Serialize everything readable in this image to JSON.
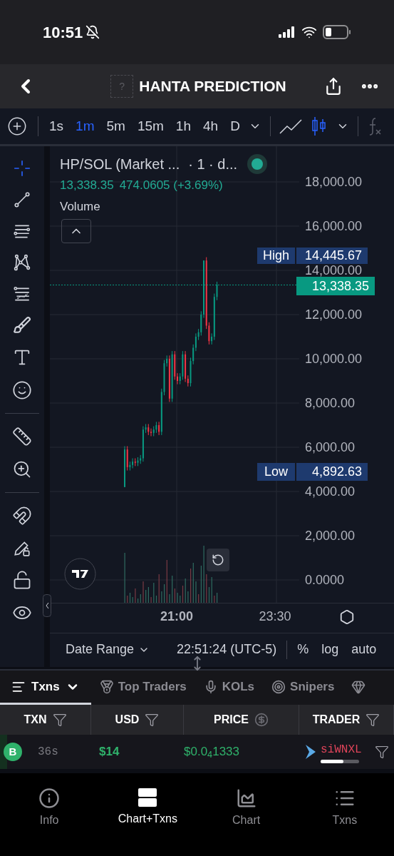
{
  "status_bar": {
    "time": "10:51"
  },
  "header": {
    "logo_placeholder": "?",
    "title": "HANTA PREDICTION"
  },
  "intervals": [
    {
      "label": "1s",
      "selected": false
    },
    {
      "label": "1m",
      "selected": true
    },
    {
      "label": "5m",
      "selected": false
    },
    {
      "label": "15m",
      "selected": false
    },
    {
      "label": "1h",
      "selected": false
    },
    {
      "label": "4h",
      "selected": false
    },
    {
      "label": "D",
      "selected": false
    }
  ],
  "chart_styles": [
    {
      "kind": "line",
      "selected": false
    },
    {
      "kind": "candles",
      "selected": true
    }
  ],
  "drawing_tools": [
    {
      "kind": "crosshair",
      "selected": true
    },
    {
      "kind": "trend-line",
      "selected": false
    },
    {
      "kind": "parallel-lines",
      "selected": false
    },
    {
      "kind": "pattern",
      "selected": false
    },
    {
      "kind": "fib",
      "selected": false
    },
    {
      "kind": "brush",
      "selected": false
    },
    {
      "kind": "text",
      "selected": false
    },
    {
      "kind": "emoji",
      "selected": false
    },
    {
      "kind": "divider"
    },
    {
      "kind": "ruler",
      "selected": false
    },
    {
      "kind": "zoom",
      "selected": false
    },
    {
      "kind": "divider"
    },
    {
      "kind": "magnet",
      "selected": false
    },
    {
      "kind": "pencil-lock",
      "selected": false
    },
    {
      "kind": "unlock",
      "selected": false
    },
    {
      "kind": "eye",
      "selected": false
    }
  ],
  "chart": {
    "symbol": "HP/SOL (Market ...",
    "interval": "· 1 · d...",
    "live": true,
    "last": "13,338.35",
    "change": "474.0605 (+3.69%)",
    "indicator": "Volume",
    "price_axis": [
      "18,000.00",
      "16,000.00",
      "14,000.00",
      "12,000.00",
      "10,000.00",
      "8,000.00",
      "6,000.00",
      "4,000.00",
      "2,000.00",
      "0.0000"
    ],
    "time_axis": [
      "21:00",
      "23:30"
    ],
    "high": {
      "label": "High",
      "value": "14,445.67"
    },
    "current_price": "13,338.35",
    "low": {
      "label": "Low",
      "value": "4,892.63"
    }
  },
  "range_bar": {
    "date_range": "Date Range",
    "clock": "22:51:24 (UTC-5)",
    "options": [
      "%",
      "log",
      "auto"
    ]
  },
  "tabs": [
    {
      "kind": "list",
      "label": "Txns",
      "selected": true
    },
    {
      "kind": "medal",
      "label": "Top Traders",
      "selected": false
    },
    {
      "kind": "mic",
      "label": "KOLs",
      "selected": false
    },
    {
      "kind": "target",
      "label": "Snipers",
      "selected": false
    },
    {
      "kind": "gem",
      "selected": false
    }
  ],
  "table": {
    "columns": [
      {
        "label": "TXN",
        "kind": "filter"
      },
      {
        "label": "USD",
        "kind": "filter"
      },
      {
        "label": "PRICE",
        "kind": "currency"
      },
      {
        "label": "TRADER",
        "kind": "filter"
      }
    ],
    "rows": [
      {
        "kind": "buy",
        "side": "B",
        "age": "36s",
        "usd": "$14",
        "price": "$0.0$_{4}$1333",
        "trader": "siWNXL",
        "level": 0.6
      }
    ]
  },
  "nav": [
    {
      "kind": "info",
      "label": "Info",
      "selected": false
    },
    {
      "kind": "split",
      "label": "Chart+Txns",
      "selected": true
    },
    {
      "kind": "chart",
      "label": "Chart",
      "selected": false
    },
    {
      "kind": "list",
      "label": "Txns",
      "selected": false
    }
  ]
}
